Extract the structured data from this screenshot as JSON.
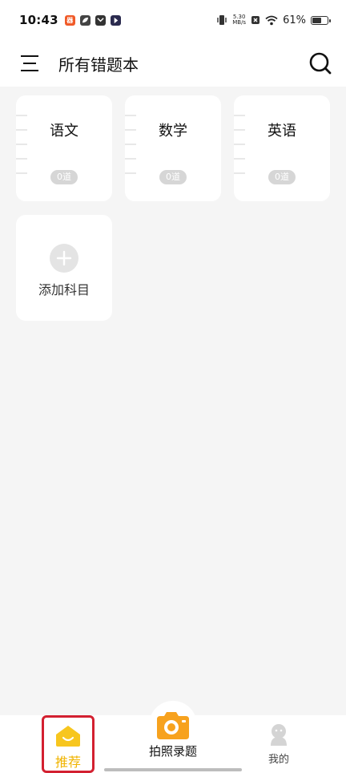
{
  "status_bar": {
    "time": "10:43",
    "notifications": [
      {
        "icon": "app-badge-icon",
        "glyph": "器",
        "color": "#f05a28"
      },
      {
        "icon": "leaf-app-icon",
        "glyph": "",
        "color": "#444444"
      },
      {
        "icon": "mail-app-icon",
        "glyph": "",
        "color": "#333333"
      },
      {
        "icon": "play-app-icon",
        "glyph": "",
        "color": "#2b2b4f"
      }
    ],
    "speed_value": "5.30",
    "speed_unit": "MB/s",
    "battery_percent": "61%",
    "battery_level": 0.61
  },
  "header": {
    "title": "所有错题本"
  },
  "subjects": [
    {
      "name": "语文",
      "count": "0道"
    },
    {
      "name": "数学",
      "count": "0道"
    },
    {
      "name": "英语",
      "count": "0道"
    }
  ],
  "add_subject": {
    "label": "添加科目"
  },
  "bottom_nav": {
    "home_label": "推荐",
    "camera_label": "拍照录题",
    "mine_label": "我的"
  },
  "colors": {
    "accent_yellow": "#f7c61e",
    "camera_orange": "#f7a21e",
    "highlight_red": "#d32030",
    "background": "#f5f5f5"
  }
}
